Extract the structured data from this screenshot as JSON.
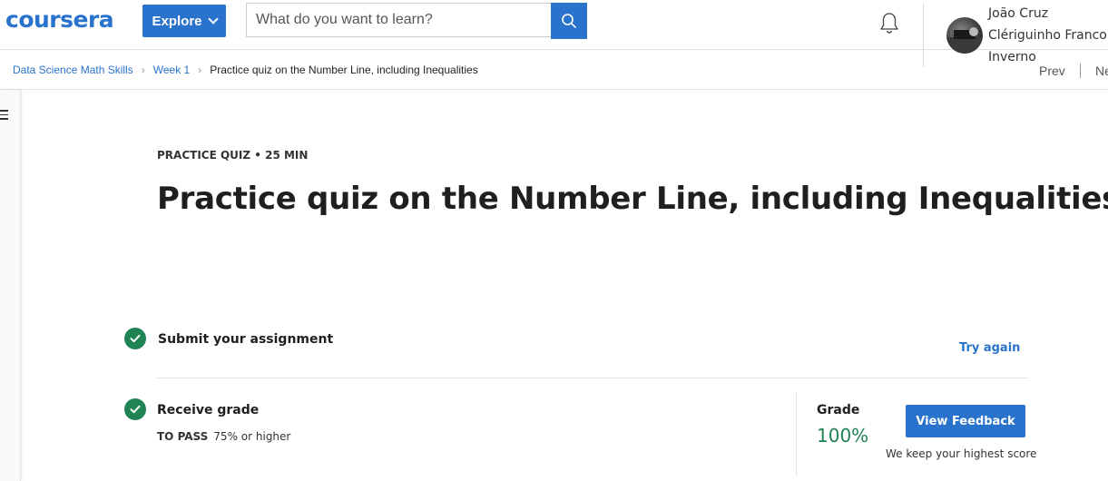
{
  "header": {
    "logo_text": "coursera",
    "explore_label": "Explore",
    "search_placeholder": "What do you want to learn?",
    "user": {
      "name_line1": "João Cruz",
      "name_line2": "Clériguinho Franco",
      "name_line3": "Inverno"
    }
  },
  "breadcrumb": {
    "items": [
      "Data Science Math Skills",
      "Week 1"
    ],
    "current": "Practice quiz on the Number Line, including Inequalities"
  },
  "nav": {
    "prev": "Prev",
    "next": "Next"
  },
  "quiz": {
    "eyebrow": "PRACTICE QUIZ • 25 MIN",
    "title": "Practice quiz on the Number Line, including Inequalities",
    "steps": [
      {
        "label": "Submit your assignment",
        "action": "Try again"
      },
      {
        "label": "Receive grade",
        "to_pass_label": "TO PASS",
        "to_pass_value": "75% or higher"
      }
    ],
    "grade_label": "Grade",
    "grade_value": "100%",
    "feedback_button": "View Feedback",
    "highest_note": "We keep your highest score"
  },
  "colors": {
    "brand": "#2a73cc",
    "success": "#1f8354"
  }
}
